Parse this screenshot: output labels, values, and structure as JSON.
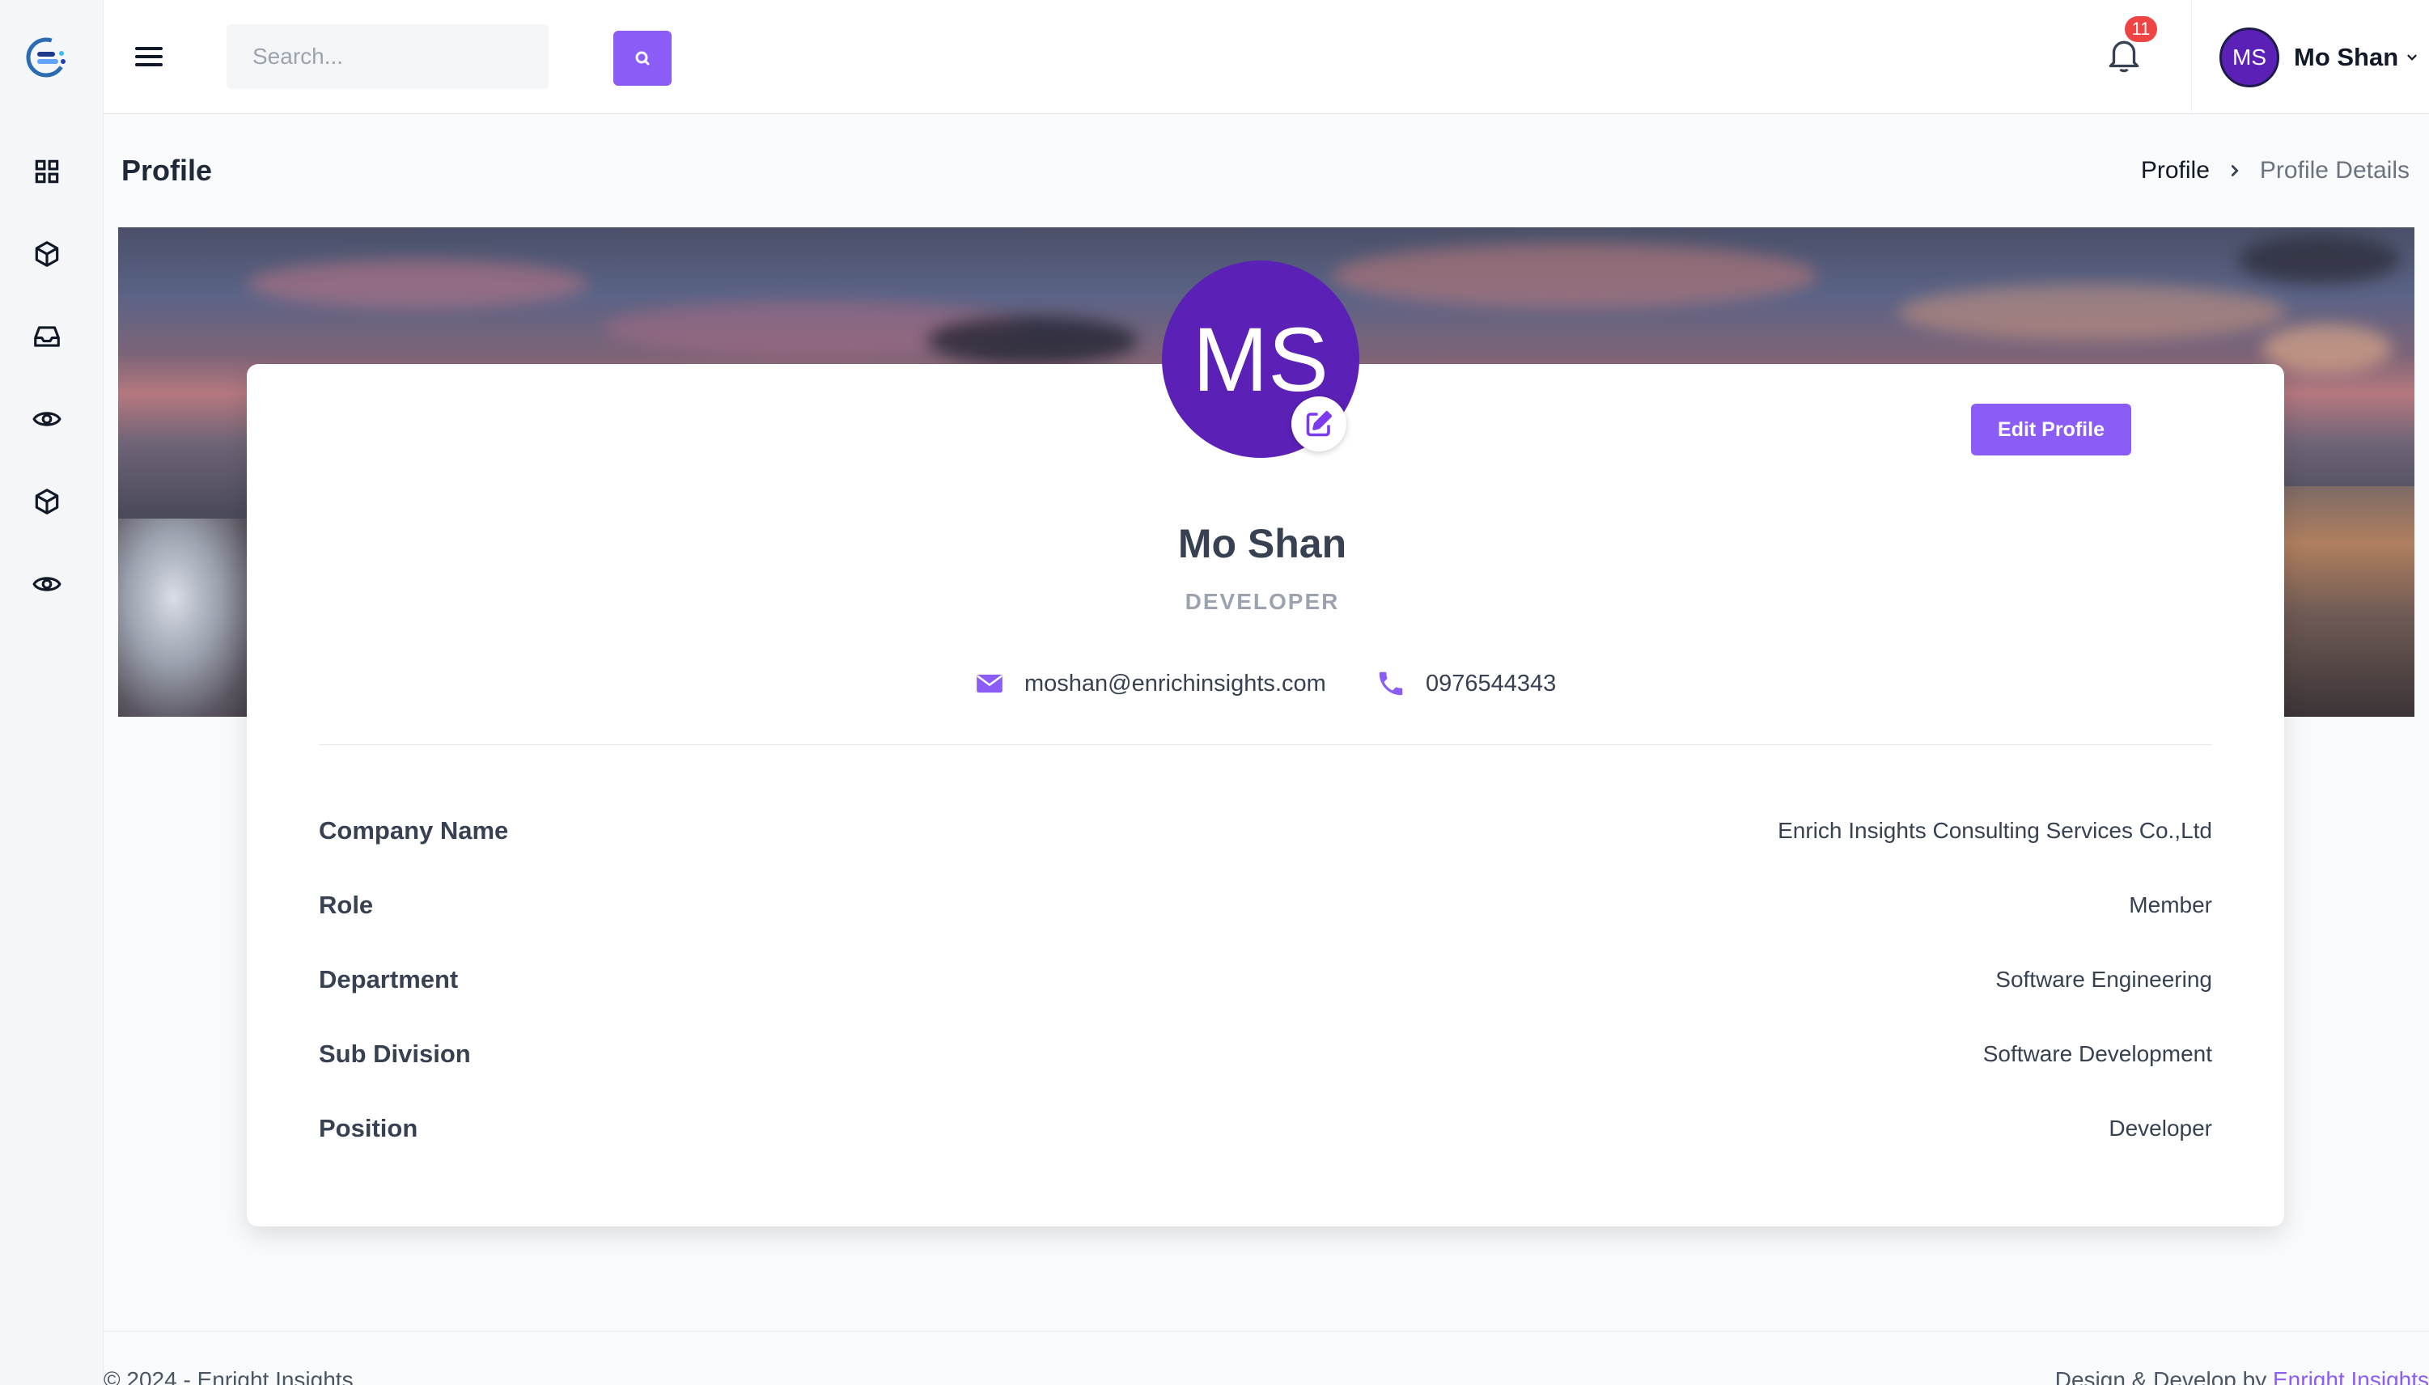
{
  "header": {
    "search_placeholder": "Search...",
    "notification_count": "11",
    "user_initials": "MS",
    "user_name": "Mo Shan"
  },
  "sidebar": {
    "items": [
      {
        "icon": "dashboard-grid-icon"
      },
      {
        "icon": "cube-icon"
      },
      {
        "icon": "inbox-icon"
      },
      {
        "icon": "eye-icon"
      },
      {
        "icon": "cube-icon"
      },
      {
        "icon": "eye-icon"
      }
    ]
  },
  "page": {
    "title": "Profile",
    "breadcrumb": [
      "Profile",
      "Profile Details"
    ]
  },
  "profile": {
    "initials": "MS",
    "name": "Mo Shan",
    "role": "DEVELOPER",
    "email": "moshan@enrichinsights.com",
    "phone": "0976544343",
    "edit_label": "Edit Profile",
    "details": [
      {
        "label": "Company Name",
        "value": "Enrich Insights Consulting Services Co.,Ltd"
      },
      {
        "label": "Role",
        "value": "Member"
      },
      {
        "label": "Department",
        "value": "Software Engineering"
      },
      {
        "label": "Sub Division",
        "value": "Software Development"
      },
      {
        "label": "Position",
        "value": "Developer"
      }
    ]
  },
  "footer": {
    "copyright": "© 2024 - Enright Insights",
    "credit_prefix": "Design & Develop by ",
    "credit_link": "Enright Insights"
  },
  "colors": {
    "accent": "#8b5cf6",
    "avatar": "#5b21b6",
    "badge": "#ef4444"
  }
}
